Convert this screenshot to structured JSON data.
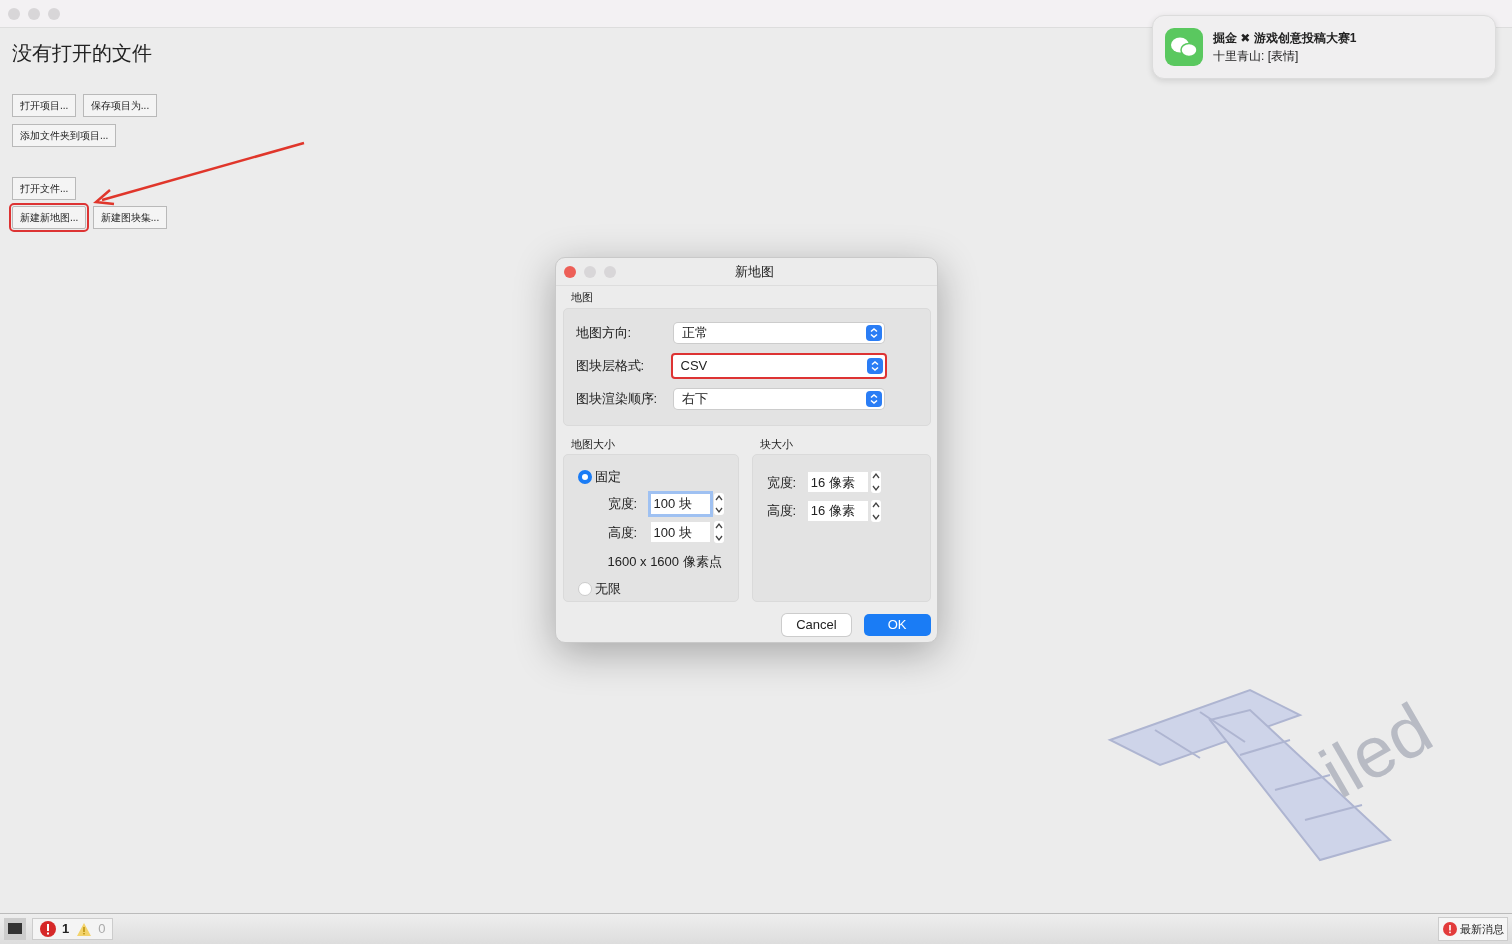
{
  "start_page": {
    "heading": "没有打开的文件",
    "groups": [
      [
        [
          {
            "label": "打开项目...",
            "highlighted": false
          },
          {
            "label": "保存项目为...",
            "highlighted": false
          }
        ],
        [
          {
            "label": "添加文件夹到项目...",
            "highlighted": false
          }
        ]
      ],
      [
        [
          {
            "label": "打开文件...",
            "highlighted": false
          }
        ],
        [
          {
            "label": "新建新地图...",
            "highlighted": true
          },
          {
            "label": "新建图块集...",
            "highlighted": false
          }
        ]
      ]
    ]
  },
  "notification": {
    "title": "掘金 ✖ 游戏创意投稿大赛1",
    "message": "十里青山: [表情]"
  },
  "dialog": {
    "title": "新地图",
    "map": {
      "title": "地图",
      "fields": [
        {
          "label": "地图方向:",
          "value": "正常",
          "highlighted": false
        },
        {
          "label": "图块层格式:",
          "value": "CSV",
          "highlighted": true
        },
        {
          "label": "图块渲染顺序:",
          "value": "右下",
          "highlighted": false
        }
      ]
    },
    "map_size": {
      "title": "地图大小",
      "options": [
        {
          "label": "固定",
          "selected": true
        },
        {
          "label": "无限",
          "selected": false
        }
      ],
      "fields": [
        {
          "label": "宽度:",
          "value": "100 块",
          "focused": true
        },
        {
          "label": "高度:",
          "value": "100 块",
          "focused": false
        }
      ],
      "summary": "1600 x 1600 像素点"
    },
    "tile_size": {
      "title": "块大小",
      "fields": [
        {
          "label": "宽度:",
          "value": "16 像素",
          "focused": false
        },
        {
          "label": "高度:",
          "value": "16 像素",
          "focused": false
        }
      ]
    },
    "buttons": [
      {
        "label": "Cancel",
        "default": false
      },
      {
        "label": "OK",
        "default": true
      }
    ]
  },
  "logo": {
    "text": "iled"
  },
  "status_bar": {
    "errors": "1",
    "warnings": "0",
    "news": "最新消息"
  }
}
